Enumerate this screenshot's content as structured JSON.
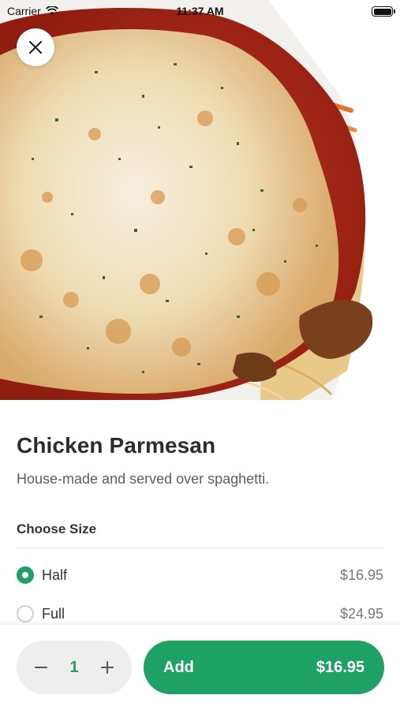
{
  "status_bar": {
    "carrier": "Carrier",
    "time": "11:37 AM",
    "icons": [
      "wifi-icon",
      "battery-icon"
    ]
  },
  "hero": {
    "image_subject": "chicken parmesan with melted cheese, tomato sauce and spaghetti",
    "close_icon": "close-icon"
  },
  "item": {
    "title": "Chicken Parmesan",
    "description": "House-made and served over spaghetti."
  },
  "size_section": {
    "title": "Choose Size",
    "options": [
      {
        "label": "Half",
        "price": "$16.95",
        "selected": true
      },
      {
        "label": "Full",
        "price": "$24.95",
        "selected": false
      }
    ]
  },
  "order": {
    "quantity": "1",
    "minus_icon": "minus-icon",
    "plus_icon": "plus-icon",
    "add_label": "Add",
    "add_price": "$16.95"
  },
  "colors": {
    "accent": "#1ea164",
    "stepper_bg": "#eeeeee",
    "text_primary": "#2c2c2c",
    "text_secondary": "#5d5d5d"
  }
}
